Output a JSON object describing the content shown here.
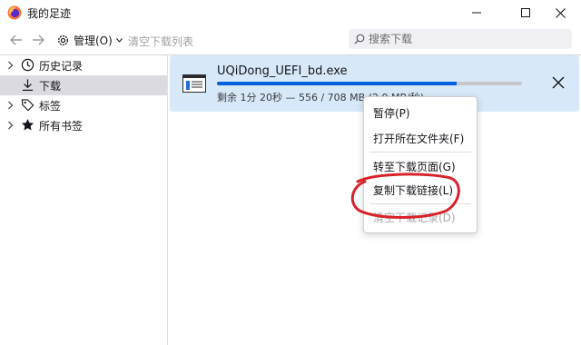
{
  "window": {
    "title": "我的足迹",
    "minimize_icon": "minimize-icon",
    "maximize_icon": "maximize-icon",
    "close_icon": "close-icon"
  },
  "toolbar": {
    "back_icon": "back-arrow-icon",
    "forward_icon": "forward-arrow-icon",
    "manage_label": "管理(O)",
    "clear_downloads_label": "清空下载列表"
  },
  "search": {
    "placeholder": "搜索下载"
  },
  "sidebar": {
    "items": [
      {
        "label": "历史记录",
        "icon": "clock-icon",
        "expandable": true
      },
      {
        "label": "下载",
        "icon": "download-arrow-icon",
        "expandable": false,
        "selected": true
      },
      {
        "label": "标签",
        "icon": "tag-icon",
        "expandable": true
      },
      {
        "label": "所有书签",
        "icon": "star-icon",
        "expandable": true
      }
    ]
  },
  "download": {
    "filename": "UQiDong_UEFI_bd.exe",
    "status": "剩余 1分 20秒 — 556 / 708 MB (2.0 MB/秒)",
    "progress": 0.785,
    "file_icon": "executable-file-icon",
    "cancel_icon": "close-icon"
  },
  "context_menu": {
    "items": [
      {
        "label": "暂停(P)",
        "disabled": false
      },
      {
        "label": "打开所在文件夹(F)",
        "disabled": false
      },
      {
        "label": "转至下载页面(G)",
        "disabled": false
      },
      {
        "label": "复制下载链接(L)",
        "disabled": false
      },
      {
        "label": "清空下载记录(D)",
        "disabled": true
      }
    ]
  },
  "colors": {
    "accent": "#0060df",
    "download_row_bg": "#d7e9f8",
    "selected_sidebar_bg": "#dadae0",
    "annotation": "#d8232a"
  }
}
